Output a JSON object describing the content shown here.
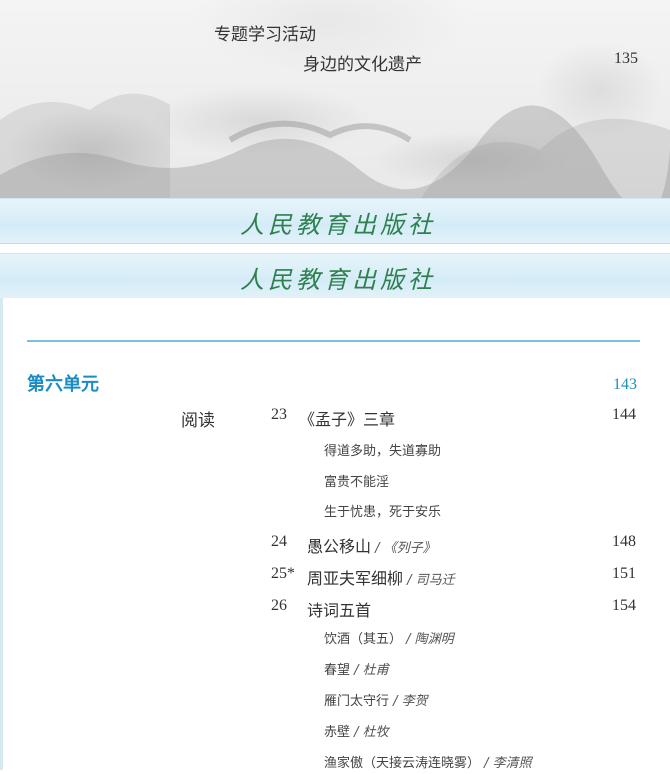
{
  "top": {
    "topic_title": "专题学习活动",
    "heritage_title": "身边的文化遗产",
    "heritage_page": "135"
  },
  "publisher_band_text": "人民教育出版社",
  "unit": {
    "title": "第六单元",
    "page": "143",
    "section_label": "阅读",
    "entries": [
      {
        "num": "23",
        "title": "《孟子》三章",
        "author": "",
        "page": "144",
        "subitems": [
          {
            "title": "得道多助，失道寡助",
            "author": ""
          },
          {
            "title": "富贵不能淫",
            "author": ""
          },
          {
            "title": "生于忧患，死于安乐",
            "author": ""
          }
        ]
      },
      {
        "num": "24",
        "title": "愚公移山",
        "author": " / 《列子》",
        "page": "148",
        "subitems": []
      },
      {
        "num": "25*",
        "title": "周亚夫军细柳",
        "author": " / 司马迁",
        "page": "151",
        "subitems": []
      },
      {
        "num": "26",
        "title": "诗词五首",
        "author": "",
        "page": "154",
        "subitems": [
          {
            "title": "饮酒（其五）",
            "author": " / 陶渊明"
          },
          {
            "title": "春望",
            "author": " / 杜甫"
          },
          {
            "title": "雁门太守行",
            "author": " / 李贺"
          },
          {
            "title": "赤壁",
            "author": " / 杜牧"
          },
          {
            "title": "渔家傲（天接云涛连晓雾）",
            "author": " / 李清照"
          }
        ]
      }
    ]
  },
  "colors": {
    "accent_blue": "#1a8cc4",
    "rule_blue": "#7bbfdc",
    "band_blue": "#d4ecf7",
    "logo_green": "#2f7f4f"
  }
}
